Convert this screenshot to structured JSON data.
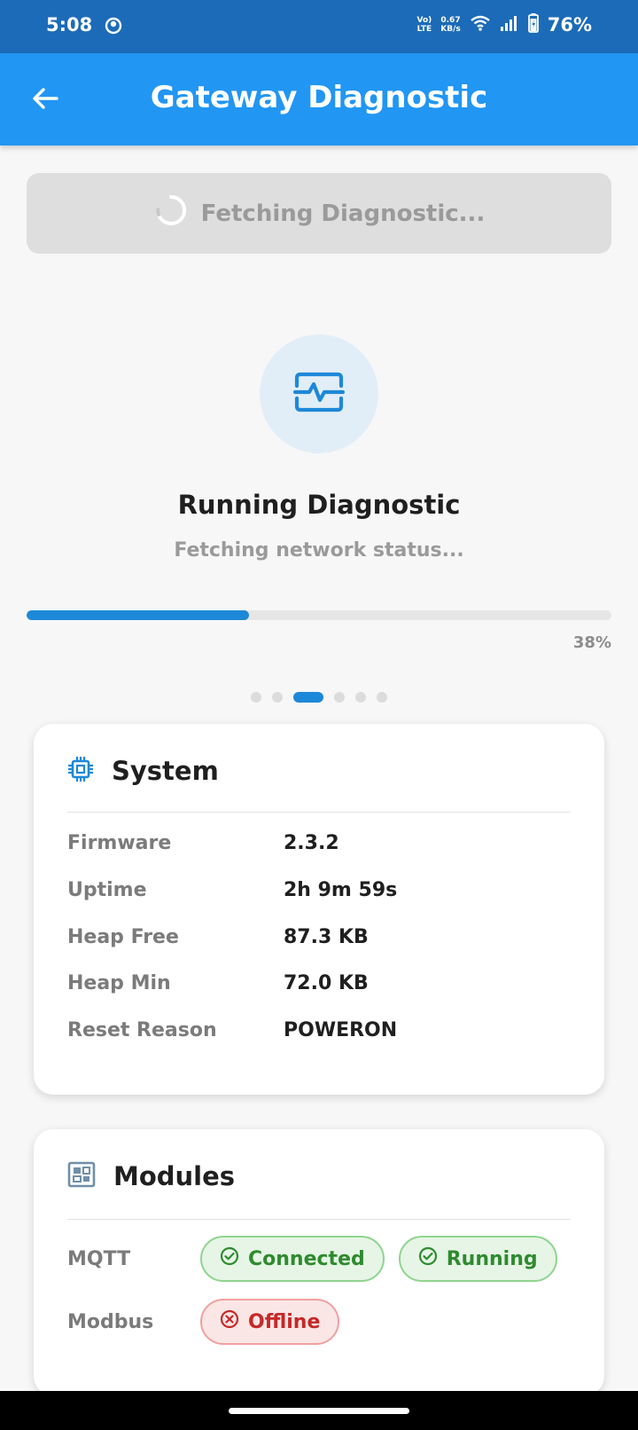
{
  "status_bar": {
    "time": "5:08",
    "volte_line1": "Vo)",
    "volte_line2": "LTE",
    "net_speed_value": "0.67",
    "net_speed_unit": "KB/s",
    "battery": "76%"
  },
  "app_bar": {
    "title": "Gateway Diagnostic"
  },
  "fetch_button": {
    "label": "Fetching Diagnostic..."
  },
  "diagnostic": {
    "title": "Running Diagnostic",
    "subtitle": "Fetching network status...",
    "progress": 38,
    "progress_label": "38%",
    "step_count": 6,
    "active_step": 2
  },
  "system_card": {
    "title": "System",
    "rows": [
      {
        "label": "Firmware",
        "value": "2.3.2"
      },
      {
        "label": "Uptime",
        "value": "2h 9m 59s"
      },
      {
        "label": "Heap Free",
        "value": "87.3 KB"
      },
      {
        "label": "Heap Min",
        "value": "72.0 KB"
      },
      {
        "label": "Reset Reason",
        "value": "POWERON"
      }
    ]
  },
  "modules_card": {
    "title": "Modules",
    "rows": [
      {
        "label": "MQTT",
        "chips": [
          {
            "text": "Connected",
            "status": "ok"
          },
          {
            "text": "Running",
            "status": "ok"
          }
        ]
      },
      {
        "label": "Modbus",
        "chips": [
          {
            "text": "Offline",
            "status": "error"
          }
        ]
      }
    ]
  },
  "colors": {
    "status_bar": "#1c6bb8",
    "app_bar": "#2196f3",
    "accent": "#1e88d8",
    "ok": "#2e8b2e",
    "error": "#c62828"
  },
  "icons": {
    "back": "arrow-left-icon",
    "fetch": "spinner-icon",
    "diagnostic": "pulse-monitor-icon",
    "system": "cpu-chip-icon",
    "modules": "module-grid-icon",
    "ok": "check-circle-icon",
    "error": "x-circle-icon"
  }
}
